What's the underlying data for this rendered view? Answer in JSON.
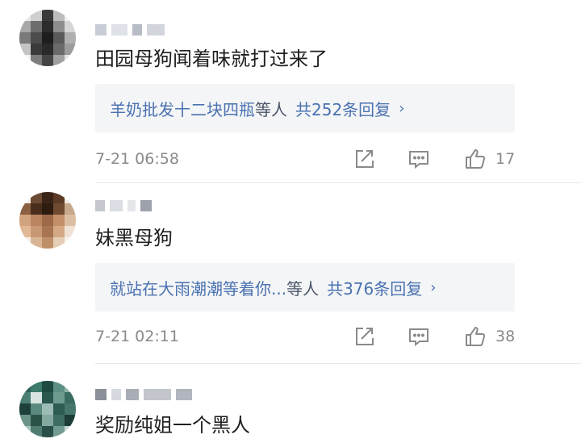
{
  "comments": [
    {
      "content": "田园母狗闻着味就打过来了",
      "reply": {
        "who": "羊奶批发十二块四瓶",
        "suffix": "等人",
        "count": "共252条回复",
        "arrow": "›"
      },
      "time": "7-21 06:58",
      "likes": "17",
      "icons": [
        "share-icon",
        "comment-icon",
        "like-icon"
      ]
    },
    {
      "content": "妹黑母狗",
      "reply": {
        "who": "就站在大雨潮潮等着你...",
        "suffix": "等人",
        "count": "共376条回复",
        "arrow": "›"
      },
      "time": "7-21 02:11",
      "likes": "38",
      "icons": [
        "share-icon",
        "comment-icon",
        "like-icon"
      ]
    },
    {
      "content": "奖励纯姐一个黑人"
    }
  ],
  "colors": {
    "reply_link": "#4a72b0",
    "meta_gray": "#8a8a8a",
    "reply_bg": "#f4f5f7"
  }
}
